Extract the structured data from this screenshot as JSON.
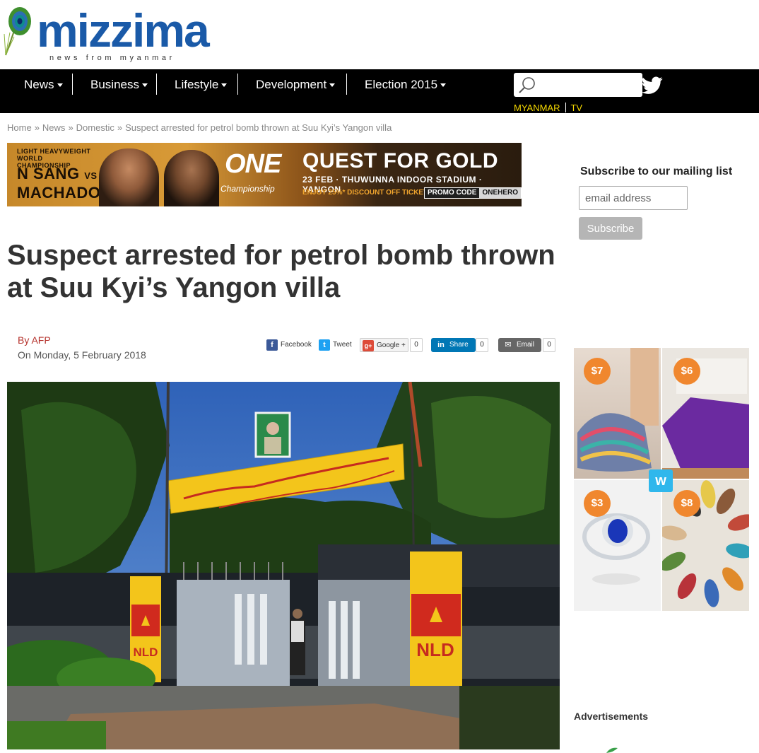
{
  "logo": {
    "wordmark": "mizzima",
    "tagline": "news from myanmar"
  },
  "nav": {
    "items": [
      {
        "label": "News"
      },
      {
        "label": "Business"
      },
      {
        "label": "Lifestyle"
      },
      {
        "label": "Development"
      },
      {
        "label": "Election 2015"
      }
    ],
    "search_placeholder": "",
    "tv_links": {
      "myanmar": "MYANMAR",
      "tv": "TV"
    }
  },
  "breadcrumb": {
    "home": "Home",
    "news": "News",
    "domestic": "Domestic",
    "separator": "»",
    "current": "Suspect arrested for petrol bomb thrown at Suu Kyi’s Yangon villa"
  },
  "banner": {
    "championship": "LIGHT HEAVYWEIGHT WORLD CHAMPIONSHIP",
    "fighter_a": "N SANG",
    "vs": "VS",
    "fighter_b": "MACHADO",
    "brand": "ONE",
    "brand_sub": "Championship",
    "headline": "QUEST FOR GOLD",
    "event_line": "23 FEB · THUWUNNA INDOOR STADIUM · YANGON",
    "discount": "ENJOY 25%* DISCOUNT OFF TICKETS",
    "promo_label": "PROMO CODE",
    "promo_code": "ONEHERO"
  },
  "subscribe": {
    "title": "Subscribe to our mailing list",
    "email_placeholder": "email address",
    "button": "Subscribe"
  },
  "article": {
    "headline": "Suspect arrested for petrol bomb thrown at Suu Kyi’s Yangon villa",
    "byline": "By AFP",
    "date": "On Monday, 5 February 2018",
    "photo_signs": {
      "gate_left": "NLD",
      "gate_right": "NLD"
    }
  },
  "share": {
    "facebook": "Facebook",
    "tweet": "Tweet",
    "google": "Google +",
    "google_count": "0",
    "linkedin": "Share",
    "linkedin_count": "0",
    "email": "Email",
    "email_count": "0"
  },
  "sidebar_ad": {
    "prices": [
      "$7",
      "$6",
      "$3",
      "$8"
    ],
    "brand_icon": "wish-logo",
    "info_icon": "ⓘ",
    "close_icon": "✕"
  },
  "ads_label": "Advertisements",
  "colors": {
    "brand_blue": "#1a5aa8",
    "nav_bg": "#000000",
    "tv_link": "#f5d800",
    "byline_red": "#b5322c",
    "price_badge": "#f0872e"
  }
}
